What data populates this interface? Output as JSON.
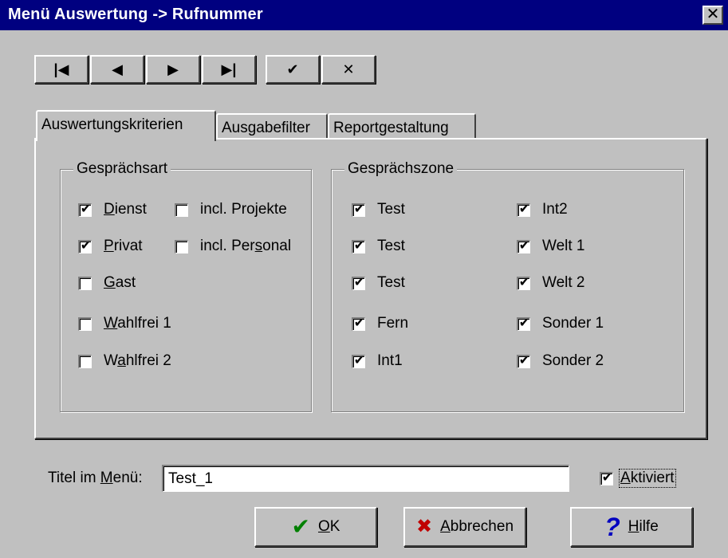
{
  "window": {
    "title": "Menü Auswertung -> Rufnummer",
    "close_glyph": "✕"
  },
  "nav": [
    {
      "name": "first-record-button",
      "glyph": "|◀"
    },
    {
      "name": "previous-record-button",
      "glyph": "◀"
    },
    {
      "name": "next-record-button",
      "glyph": "▶"
    },
    {
      "name": "last-record-button",
      "glyph": "▶|"
    },
    {
      "name": "confirm-button",
      "glyph": "✔"
    },
    {
      "name": "discard-button",
      "glyph": "✕"
    }
  ],
  "tabs": [
    {
      "label": "Auswertungskriterien",
      "active": true
    },
    {
      "label": "Ausgabefilter",
      "active": false
    },
    {
      "label": "Reportgestaltung",
      "active": false
    }
  ],
  "gespraechsart": {
    "label": "Gesprächsart",
    "items": [
      {
        "pre": "",
        "u": "D",
        "post": "ienst",
        "checked": true
      },
      {
        "pre": "incl. Projekte",
        "u": "",
        "post": "",
        "checked": false
      },
      {
        "pre": "",
        "u": "P",
        "post": "rivat",
        "checked": true
      },
      {
        "pre": "incl. Per",
        "u": "s",
        "post": "onal",
        "checked": false
      },
      {
        "pre": "",
        "u": "G",
        "post": "ast",
        "checked": false
      },
      {
        "pre": "",
        "u": "W",
        "post": "ahlfrei 1",
        "checked": false
      },
      {
        "pre": "W",
        "u": "a",
        "post": "hlfrei 2",
        "checked": false
      }
    ]
  },
  "gespraechszone": {
    "label": "Gesprächszone",
    "items": [
      {
        "label": "Test",
        "checked": true
      },
      {
        "label": "Int2",
        "checked": true
      },
      {
        "label": "Test",
        "checked": true
      },
      {
        "label": "Welt 1",
        "checked": true
      },
      {
        "label": "Test",
        "checked": true
      },
      {
        "label": "Welt 2",
        "checked": true
      },
      {
        "label": "Fern",
        "checked": true
      },
      {
        "label": "Sonder 1",
        "checked": true
      },
      {
        "label": "Int1",
        "checked": true
      },
      {
        "label": "Sonder 2",
        "checked": true
      }
    ]
  },
  "titel": {
    "pre": "Titel im ",
    "u": "M",
    "post": "enü:",
    "value": "Test_1"
  },
  "aktiviert": {
    "pre": "",
    "u": "A",
    "post": "ktiviert",
    "checked": true
  },
  "buttons": {
    "ok": {
      "u": "O",
      "post": "K",
      "icon": "✔",
      "icon_color": "#008000"
    },
    "abbrechen": {
      "u": "A",
      "post": "bbrechen",
      "icon": "✖",
      "icon_color": "#c00000"
    },
    "hilfe": {
      "u": "H",
      "post": "ilfe",
      "icon": "?",
      "icon_color": "#0000c0"
    }
  },
  "checkmark": "✔"
}
